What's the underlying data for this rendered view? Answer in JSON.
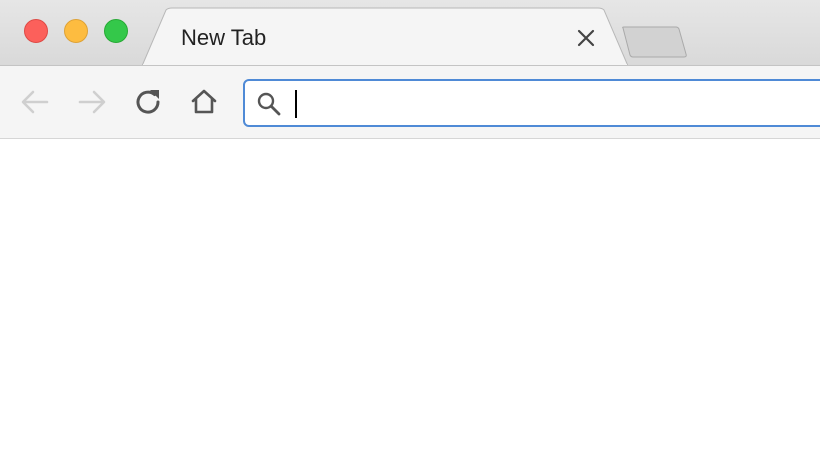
{
  "window": {
    "controls": [
      "close",
      "minimize",
      "maximize"
    ]
  },
  "tab": {
    "title": "New Tab",
    "close_icon": "close-icon"
  },
  "toolbar": {
    "back_icon": "arrow-left-icon",
    "forward_icon": "arrow-right-icon",
    "reload_icon": "reload-icon",
    "home_icon": "home-icon"
  },
  "omnibox": {
    "value": "",
    "search_icon": "search-icon",
    "focus_color": "#4f8ad6"
  },
  "colors": {
    "close": "#fc605b",
    "minimize": "#fdbc40",
    "maximize": "#34c84a"
  }
}
